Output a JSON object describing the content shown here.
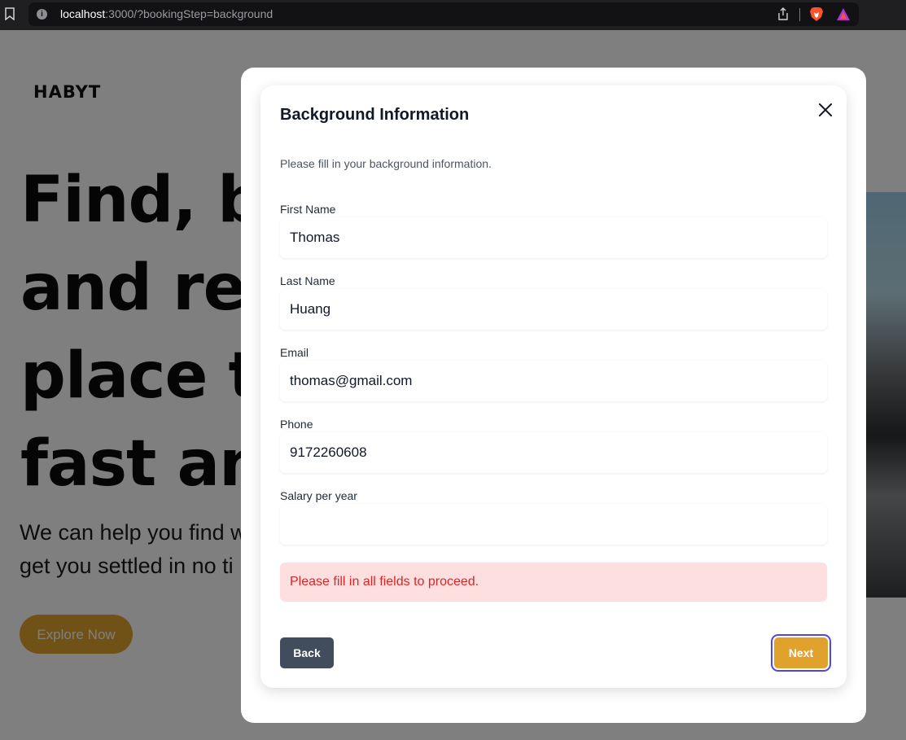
{
  "browser": {
    "url_host": "localhost",
    "url_rest": ":3000/?bookingStep=background"
  },
  "page": {
    "logo": "HABYT",
    "hero_title": "Find, book and rent a place to live fast and easy",
    "hero_title_visible_lines": [
      "Find, bo",
      "and rent",
      "place to",
      "fast and"
    ],
    "hero_subtitle_lines": [
      "We can help you find w",
      "get you settled in no ti"
    ],
    "explore_button": "Explore Now"
  },
  "modal": {
    "title": "Background Information",
    "description": "Please fill in your background information.",
    "fields": [
      {
        "label": "First Name",
        "value": "Thomas"
      },
      {
        "label": "Last Name",
        "value": "Huang"
      },
      {
        "label": "Email",
        "value": "thomas@gmail.com"
      },
      {
        "label": "Phone",
        "value": "9172260608"
      },
      {
        "label": "Salary per year",
        "value": ""
      }
    ],
    "error": "Please fill in all fields to proceed.",
    "back_label": "Back",
    "next_label": "Next"
  },
  "colors": {
    "accent": "#e1a22d",
    "error_bg": "#fddfe0",
    "error_text": "#dc2626",
    "back_bg": "#414d5c",
    "focus_ring": "#4f46e5"
  },
  "icons": {
    "close": "close-icon",
    "bookmark": "bookmark-icon",
    "share": "share-icon",
    "brave": "brave-lion-icon",
    "rewards": "brave-rewards-icon"
  }
}
